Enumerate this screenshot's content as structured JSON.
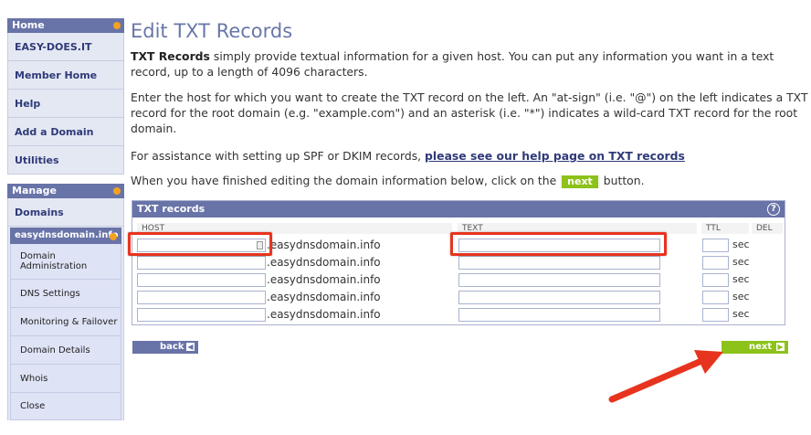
{
  "sidebar": {
    "home_header": "Home",
    "home_items": [
      "EASY-DOES.IT",
      "Member Home",
      "Help",
      "Add a Domain",
      "Utilities"
    ],
    "manage_header": "Manage",
    "domains_label": "Domains",
    "domain_header": "easydnsdomain.info",
    "domain_items": [
      "Domain Administration",
      "DNS Settings",
      "Monitoring & Failover",
      "Domain Details",
      "Whois",
      "Close"
    ]
  },
  "main": {
    "title": "Edit TXT Records",
    "intro_bold": "TXT Records",
    "intro_rest": " simply provide textual information for a given host. You can put any information you want in a text record, up to a length of 4096 characters.",
    "host_para": "Enter the host for which you want to create the TXT record on the left. An \"at-sign\" (i.e. \"@\") on the left indicates a TXT record for the root domain (e.g. \"example.com\") and an asterisk (i.e. \"*\") indicates a wild-card TXT record for the root domain.",
    "assist_text": "For assistance with setting up SPF or DKIM records, ",
    "assist_link": "please see our help page on TXT records",
    "finish_pre": "When you have finished editing the domain information below, click on the ",
    "finish_next": "next",
    "finish_post": " button."
  },
  "txt_panel": {
    "title": "TXT records",
    "help_icon": "?",
    "columns": {
      "host": "HOST",
      "text": "TEXT",
      "ttl": "TTL",
      "del": "DEL"
    },
    "domain_suffix": ".easydnsdomain.info",
    "ttl_unit": "sec",
    "rows": [
      {
        "host": "",
        "text": "",
        "ttl": ""
      },
      {
        "host": "",
        "text": "",
        "ttl": ""
      },
      {
        "host": "",
        "text": "",
        "ttl": ""
      },
      {
        "host": "",
        "text": "",
        "ttl": ""
      },
      {
        "host": "",
        "text": "",
        "ttl": ""
      }
    ]
  },
  "buttons": {
    "back": "back",
    "next": "next"
  },
  "colors": {
    "accent": "#6873a8",
    "next_green": "#8cc21a",
    "highlight_red": "#e7341e",
    "dot_orange": "#f3a11e"
  }
}
